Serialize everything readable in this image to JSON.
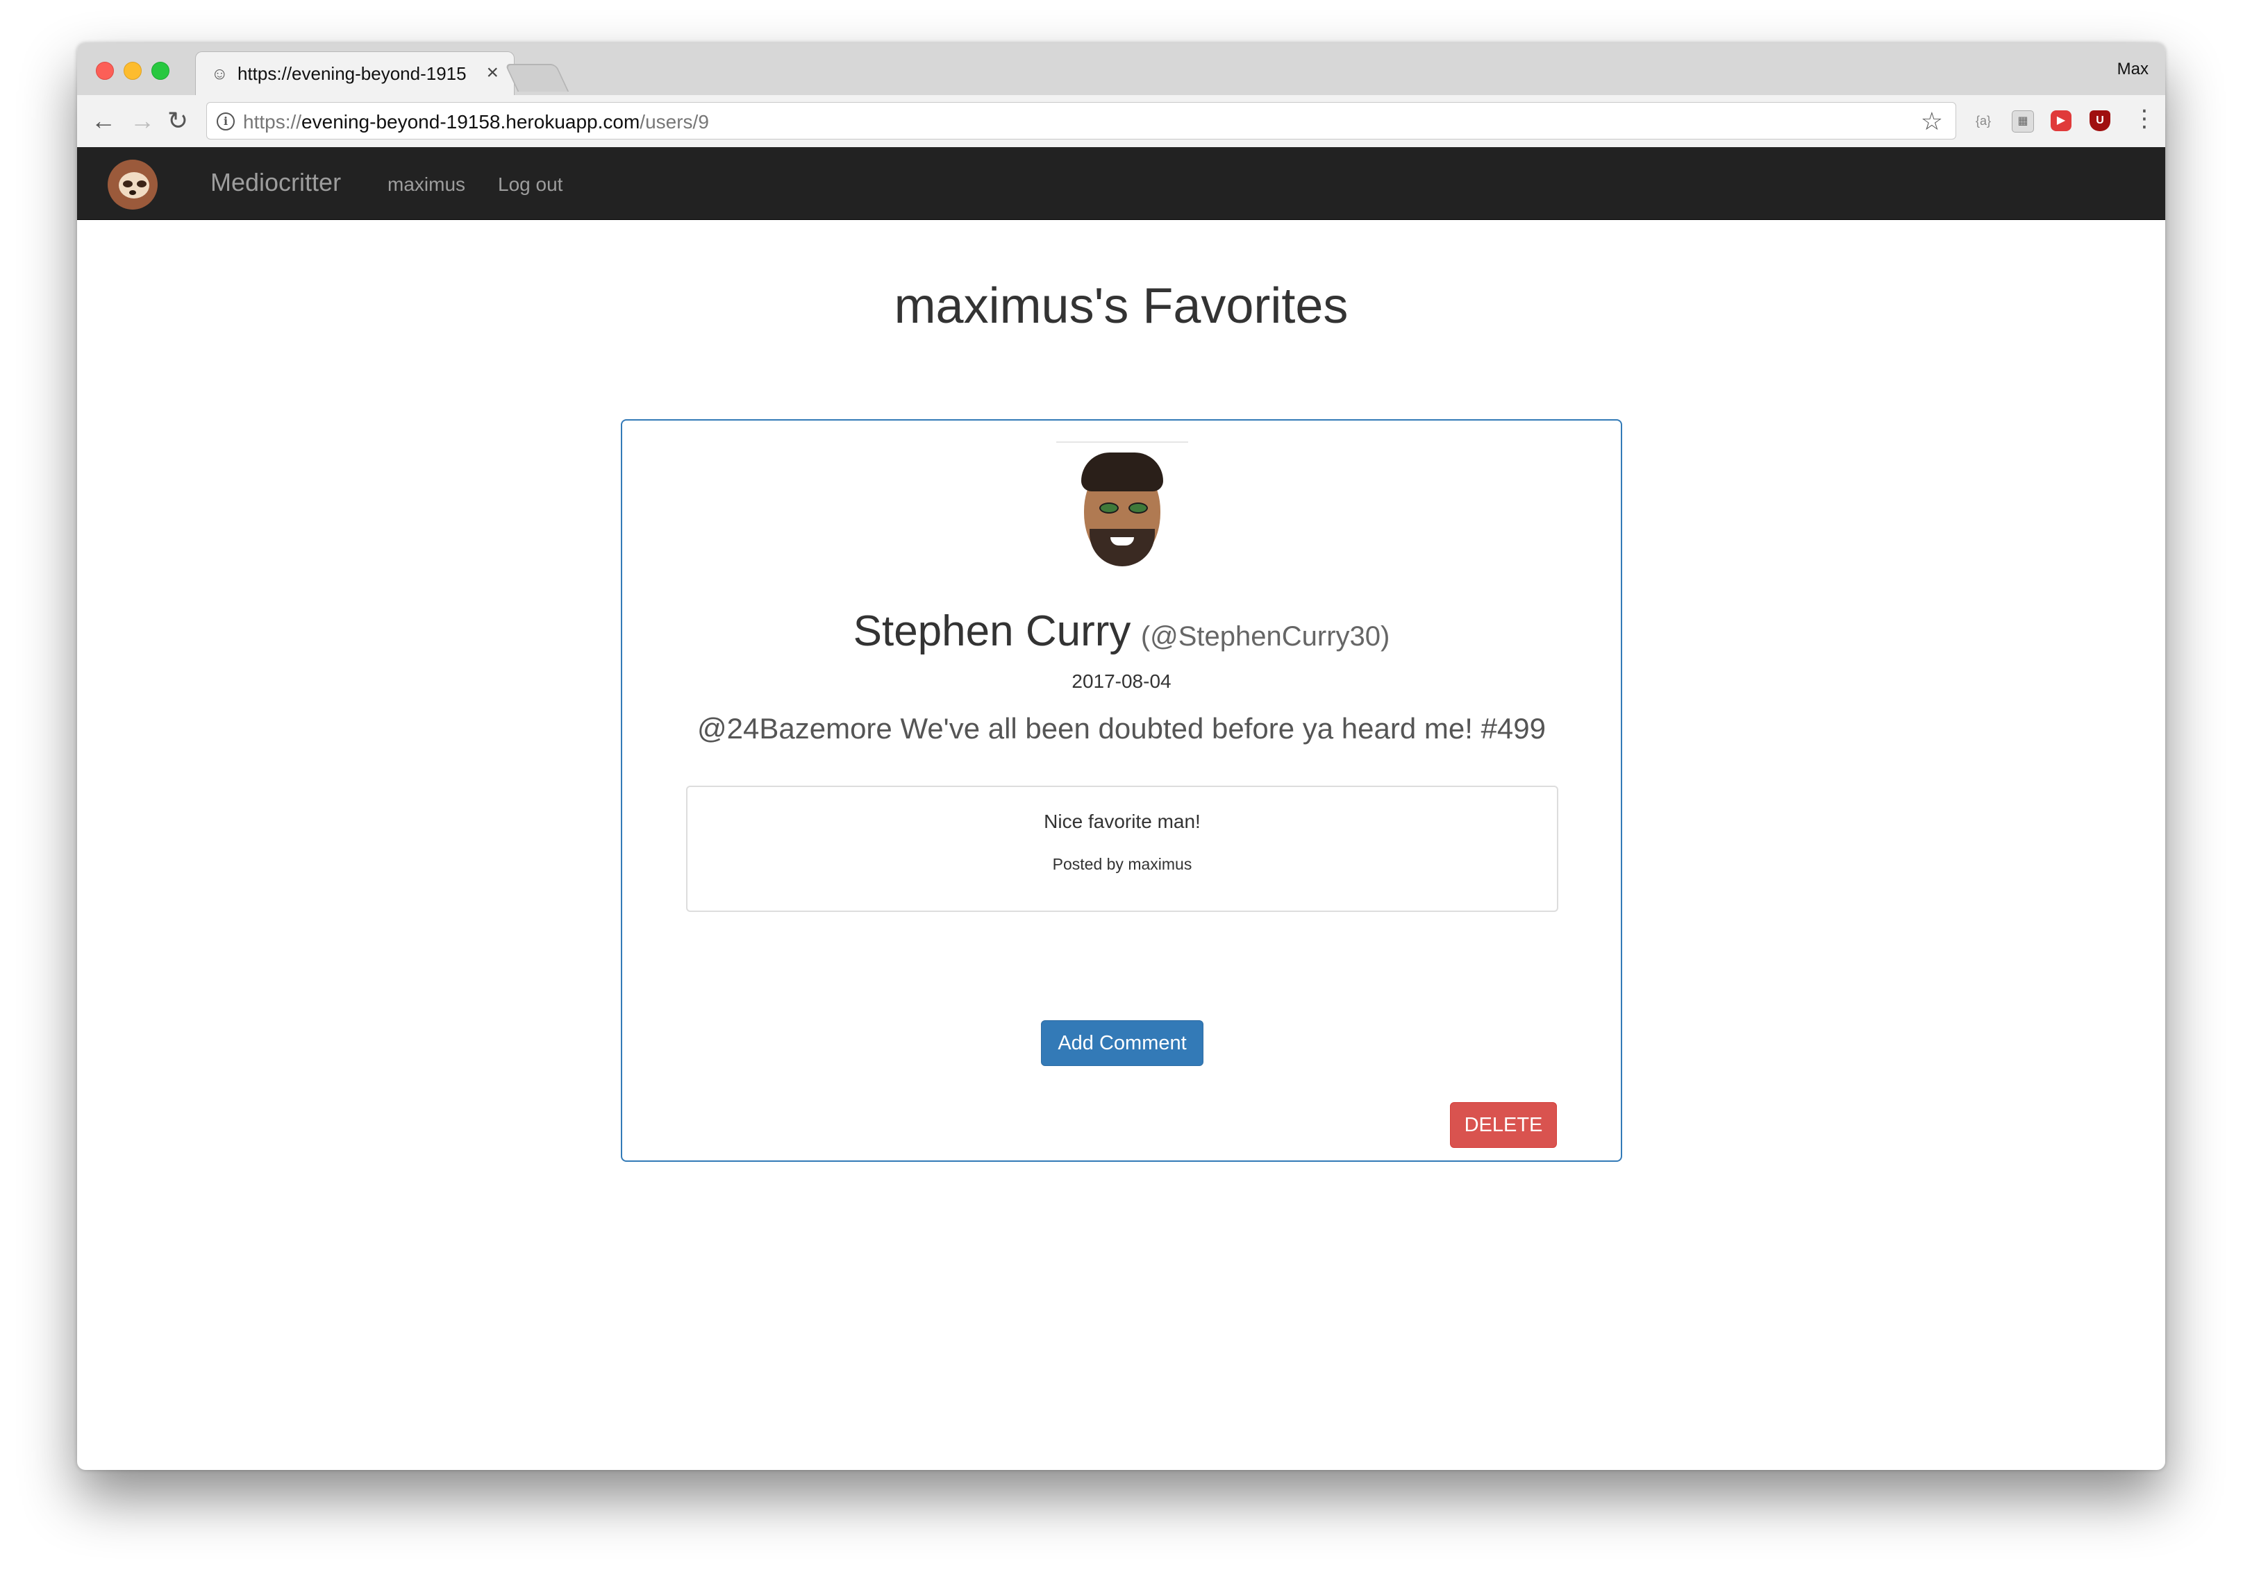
{
  "browser": {
    "tab_title": "https://evening-beyond-19158.herokuapp.com/users/9",
    "tab_close": "×",
    "profile_name": "Max",
    "url_scheme": "https://",
    "url_host": "evening-beyond-19158.herokuapp.com",
    "url_path": "/users/9",
    "extensions": [
      "json-viewer-icon",
      "grid-extension-icon",
      "youtube-extension-icon",
      "ublock-icon"
    ]
  },
  "navbar": {
    "brand": "Mediocritter",
    "user_link": "maximus",
    "logout_link": "Log out"
  },
  "page": {
    "title": "maximus's Favorites"
  },
  "favorite": {
    "name": "Stephen Curry",
    "handle": "(@StephenCurry30)",
    "date": "2017-08-04",
    "text": "@24Bazemore We've all been doubted before ya heard me! #499",
    "comments": [
      {
        "text": "Nice favorite man!",
        "author": "Posted by maximus"
      }
    ],
    "add_comment_label": "Add Comment",
    "delete_label": "DELETE"
  },
  "colors": {
    "navbar_bg": "#222222",
    "primary": "#337ab7",
    "danger": "#d9534f"
  }
}
